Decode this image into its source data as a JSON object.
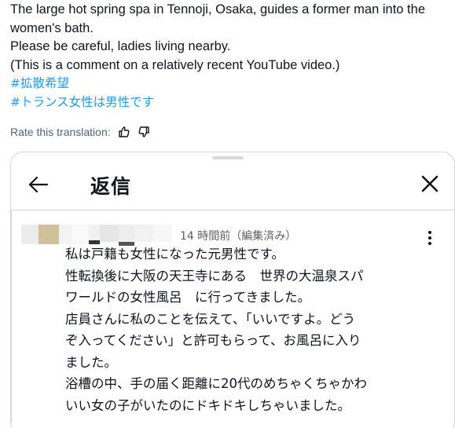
{
  "tweet": {
    "lines": [
      "The large hot spring spa in Tennoji, Osaka, guides a former man into the",
      "women's bath.",
      "Please be careful, ladies living nearby.",
      "(This is a comment on a relatively recent YouTube video.)"
    ],
    "hashtags": [
      "#拡散希望",
      "#トランス女性は男性です"
    ]
  },
  "rate": {
    "label": "Rate this translation:",
    "thumbs_up_icon": "thumbs-up-icon",
    "thumbs_down_icon": "thumbs-down-icon"
  },
  "modal": {
    "title": "返信",
    "back_icon": "arrow-left-icon",
    "close_icon": "close-icon"
  },
  "comment": {
    "timestamp": "14 時間前（編集済み）",
    "lines": [
      "私は戸籍も女性になった元男性です。",
      "性転換後に大阪の天王寺にある　世界の大温泉スパ",
      "ワールドの女性風呂　に行ってきました。",
      "店員さんに私のことを伝えて、「いいですよ。どう",
      "ぞ入ってください」と許可もらって、お風呂に入り",
      "ました。",
      "浴槽の中、手の届く距離に20代のめちゃくちゃかわ",
      "いい女の子がいたのにドキドキしちゃいました。"
    ]
  },
  "colors": {
    "hashtag": "#1d9bf0",
    "muted": "#536471",
    "border": "#cfd9de",
    "text": "#0f1419"
  }
}
